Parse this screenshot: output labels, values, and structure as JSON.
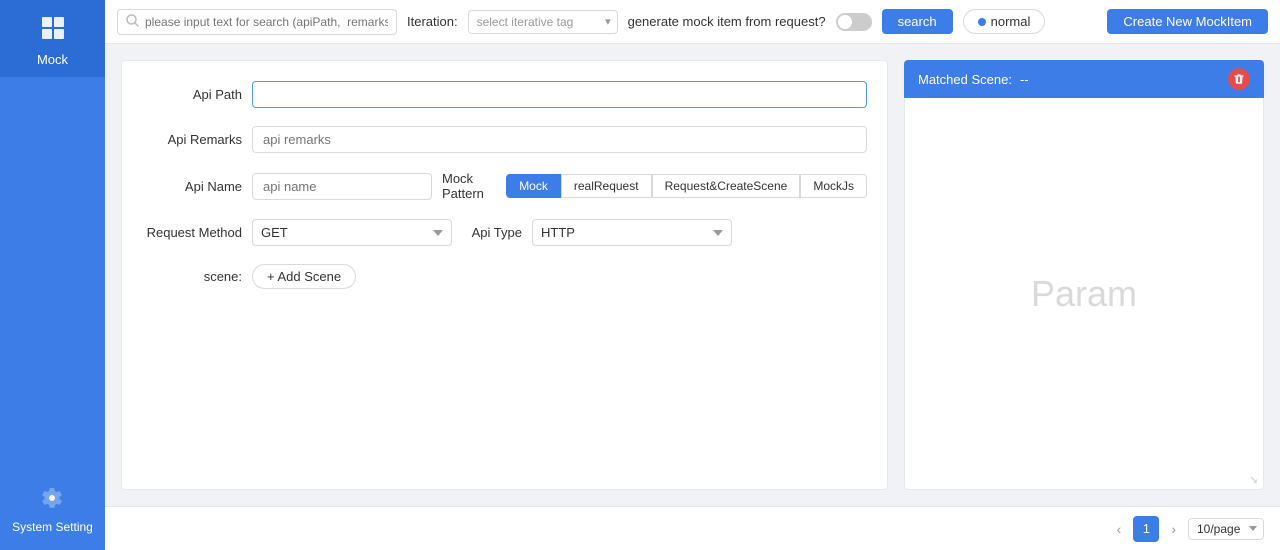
{
  "sidebar": {
    "mock_icon": "⊞",
    "mock_label": "Mock",
    "settings_icon": "⚙",
    "settings_label": "System Setting"
  },
  "toolbar": {
    "search_placeholder": "please input text for search (apiPath,  remarks)",
    "iteration_label": "Iteration:",
    "iteration_placeholder": "select iterative tag",
    "generate_label": "generate mock item from request?",
    "search_btn": "search",
    "normal_btn": "normal",
    "create_btn": "Create New MockItem"
  },
  "form": {
    "api_path_label": "Api Path",
    "api_path_value": "",
    "api_remarks_label": "Api Remarks",
    "api_remarks_placeholder": "api remarks",
    "api_name_label": "Api Name",
    "api_name_placeholder": "api name",
    "mock_pattern_label": "Mock Pattern",
    "pattern_mock": "Mock",
    "pattern_real": "realRequest",
    "pattern_request_scene": "Request&CreateScene",
    "pattern_mockjs": "MockJs",
    "request_method_label": "Request Method",
    "request_method_value": "GET",
    "api_type_label": "Api Type",
    "api_type_value": "HTTP",
    "scene_label": "scene:",
    "add_scene_btn": "+ Add Scene"
  },
  "right_panel": {
    "matched_scene_label": "Matched Scene:",
    "matched_scene_value": "--",
    "param_placeholder": "Param"
  },
  "footer": {
    "current_page": "1",
    "page_size": "10/page"
  }
}
